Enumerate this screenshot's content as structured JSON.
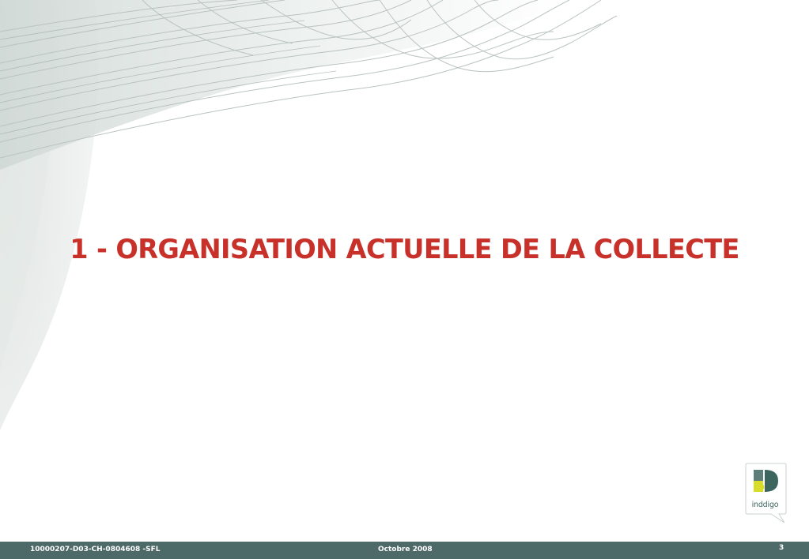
{
  "slide": {
    "title": "1 - ORGANISATION ACTUELLE DE LA COLLECTE"
  },
  "logo": {
    "text": "inddigo",
    "icon": "inddigo-logo-icon"
  },
  "footer": {
    "reference": "10000207-D03-CH-0804608 -SFL",
    "date": "Octobre 2008",
    "page_number": "3"
  },
  "colors": {
    "title": "#c8302a",
    "footer_bar": "#4e6a68",
    "logo_teal": "#3d6560",
    "logo_yellow": "#d8dc2a"
  }
}
